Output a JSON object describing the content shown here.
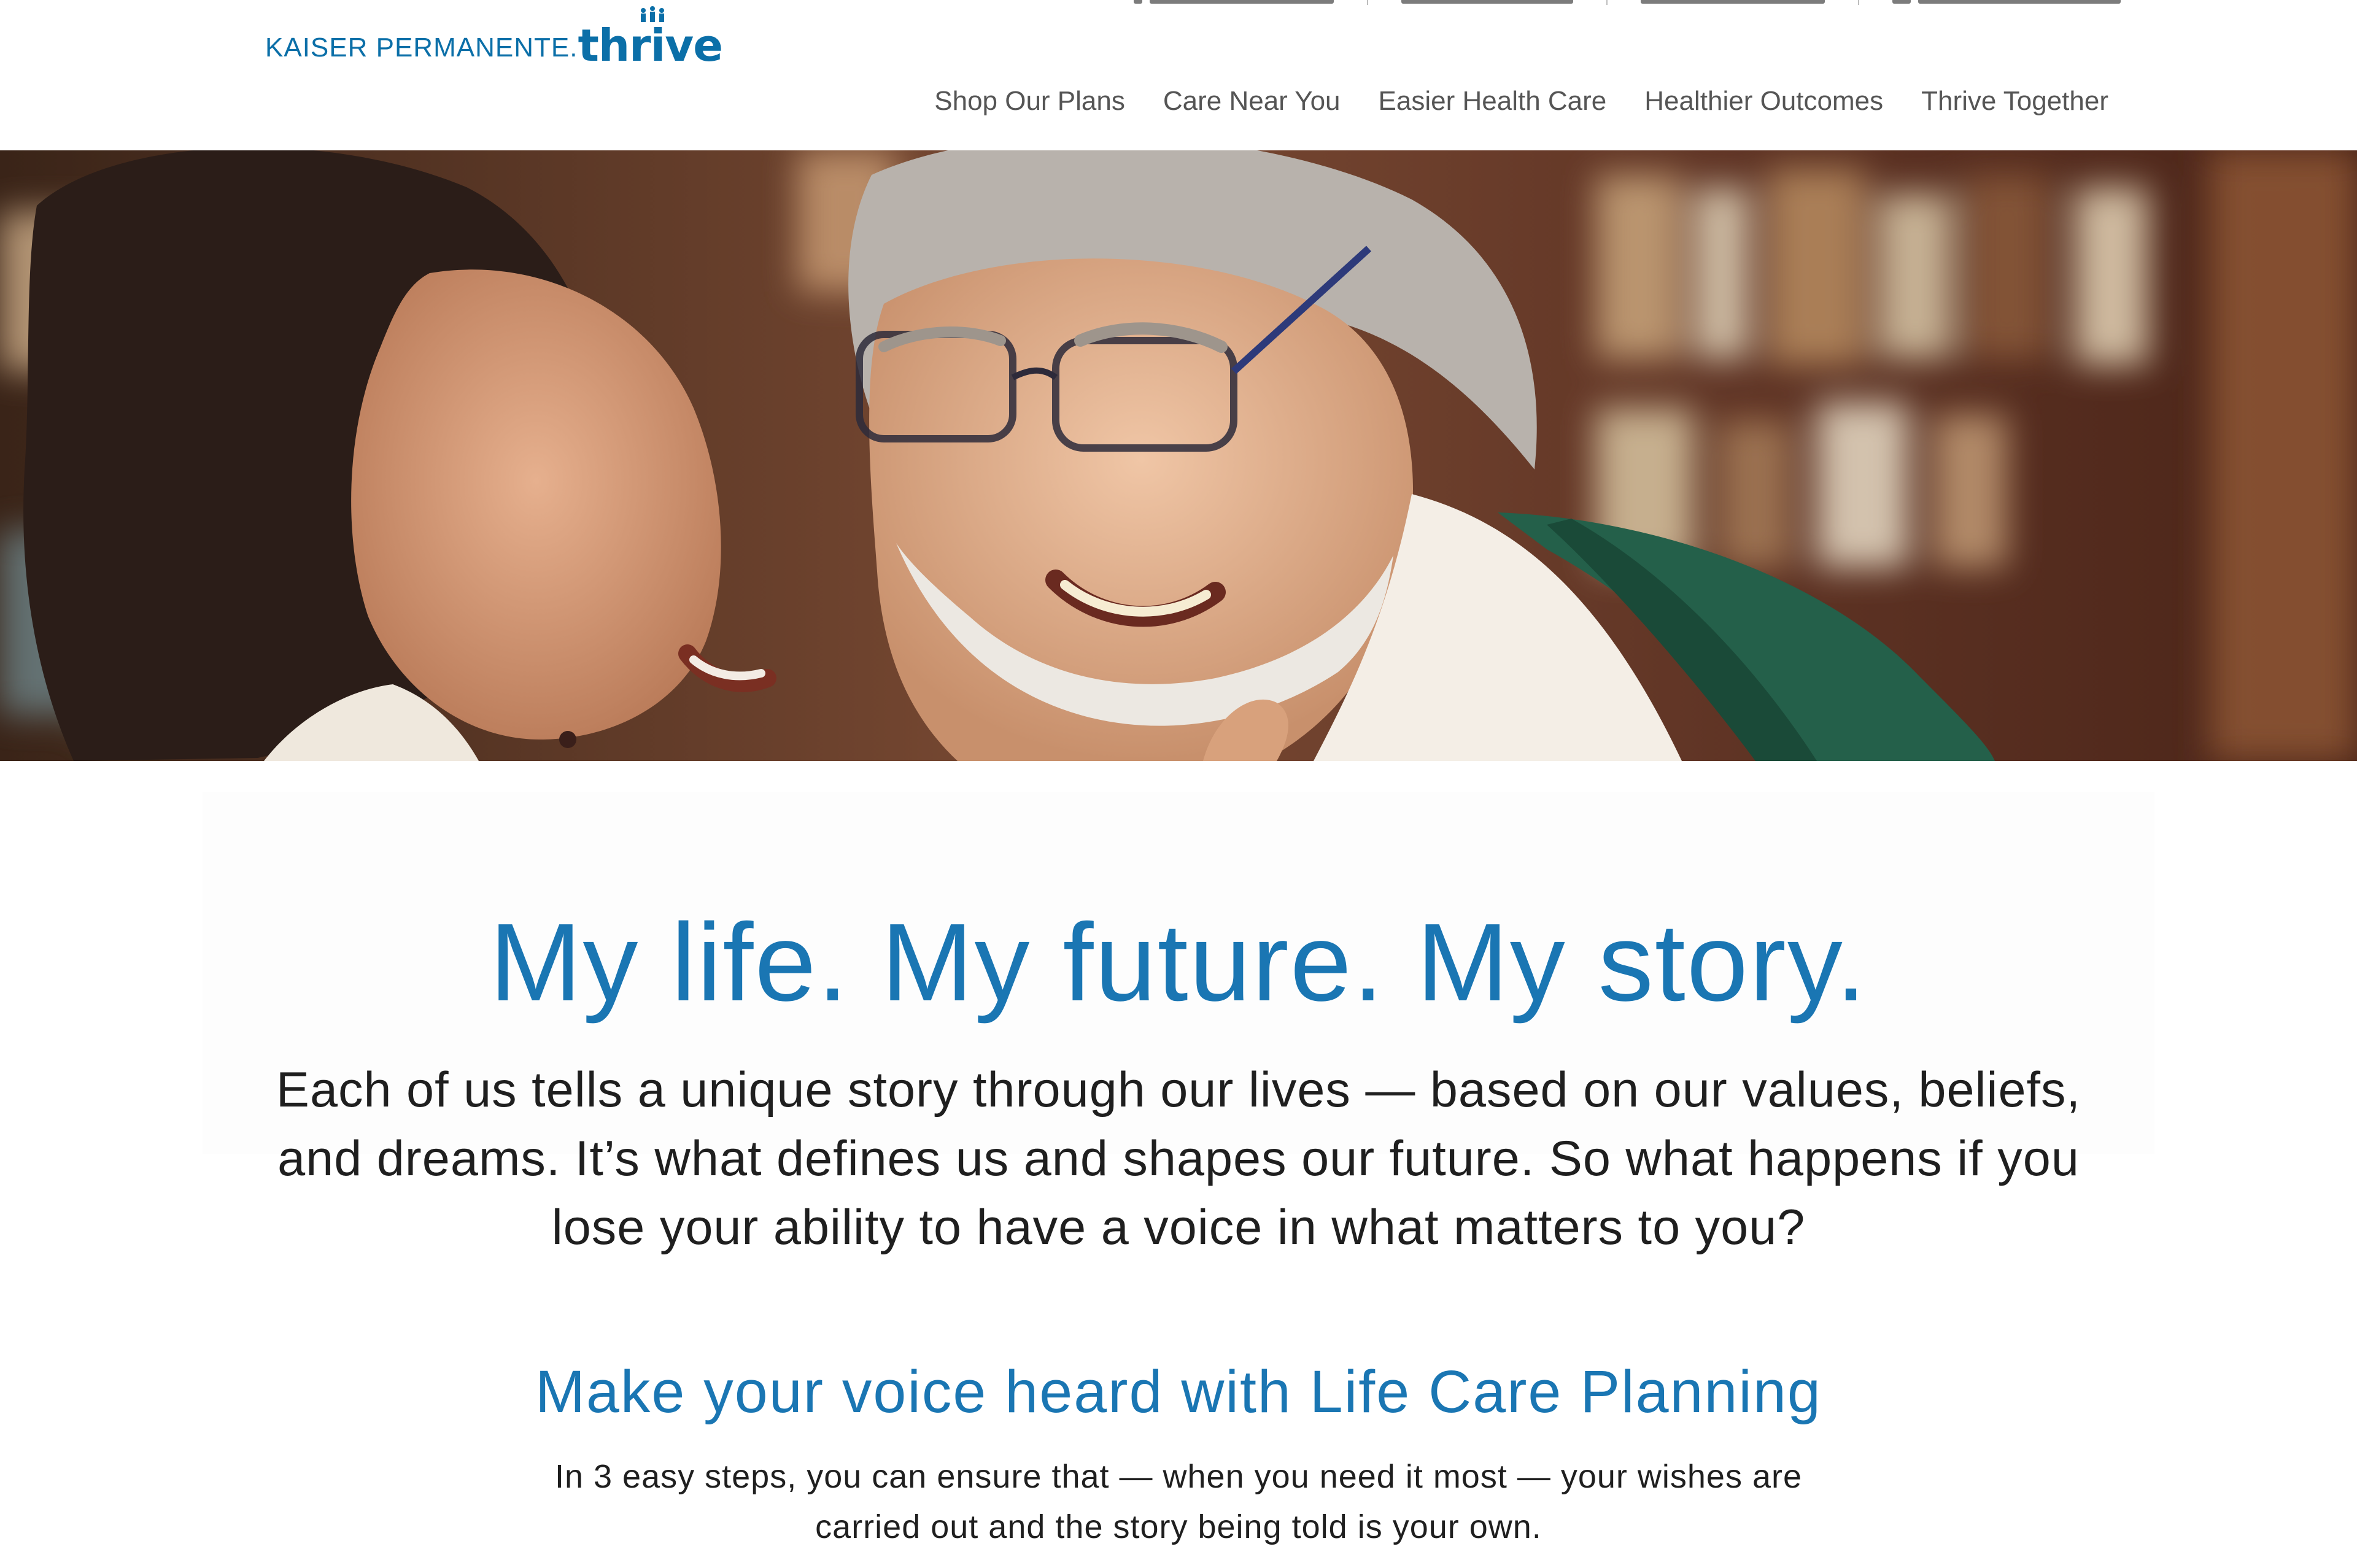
{
  "brand": {
    "kp_text": "KAISER PERMANENTE.",
    "thrive_text": "thrive",
    "color": "#0b6fa8"
  },
  "nav": {
    "items": [
      {
        "label": "Shop Our Plans"
      },
      {
        "label": "Care Near You"
      },
      {
        "label": "Easier Health Care"
      },
      {
        "label": "Healthier Outcomes"
      },
      {
        "label": "Thrive Together"
      }
    ]
  },
  "hero": {
    "image": "smiling-older-couple-photo"
  },
  "main": {
    "headline": "My life. My future. My story.",
    "intro": "Each of us tells a unique story through our lives — based on our values, beliefs, and dreams. It’s what defines us and shapes our future. So what happens if you lose your ability to have a voice in what matters to you?",
    "subheading": "Make your voice heard with Life Care Planning",
    "steps_text": "In 3 easy steps, you can ensure that — when you need it most — your wishes are carried out and the story being told is your own."
  },
  "colors": {
    "accent_blue": "#1a76b3",
    "nav_text": "#555555",
    "body_text": "#1f1f1f"
  }
}
